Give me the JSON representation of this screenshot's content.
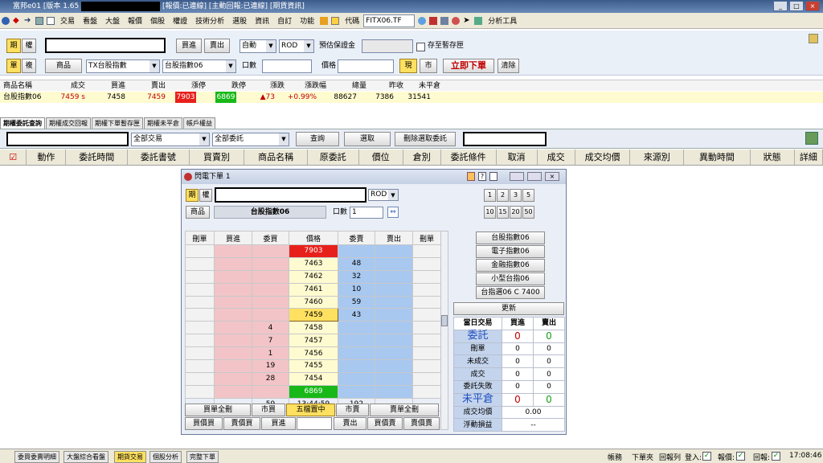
{
  "window": {
    "title": "富邦e01 [版本 1.65",
    "status": "[報價:已連線] [主動回報:已連線] [期貨資訊]",
    "win_buttons": [
      "_",
      "□",
      "×"
    ]
  },
  "menu": {
    "items": [
      "交易",
      "看盤",
      "大盤",
      "報價",
      "個股",
      "權證",
      "技術分析",
      "選股",
      "資訊",
      "自訂",
      "功能"
    ],
    "code_label": "代碼",
    "code_value": "FITX06.TF",
    "analysis_label": "分析工具"
  },
  "order": {
    "btn_futures": "期",
    "btn_options": "權",
    "btn_buy": "買進",
    "btn_sell": "賣出",
    "mode": "自動",
    "rod": "ROD",
    "margin_label": "預估保證金",
    "store_label": "存至暫存匣",
    "btn_single": "單",
    "btn_combo": "複",
    "product_label": "商品",
    "product_value": "TX台股指數",
    "contract_value": "台股指數06",
    "qty_label": "口數",
    "price_label": "價格",
    "btn_current": "現",
    "btn_market": "市",
    "btn_place": "立即下單",
    "btn_clear": "清除"
  },
  "quote": {
    "headers": [
      "商品名稱",
      "成交",
      "買進",
      "賣出",
      "漲停",
      "跌停",
      "漲跌",
      "漲跌幅",
      "總量",
      "昨收",
      "未平倉"
    ],
    "row": [
      "台股指數06",
      "7459 s",
      "7458",
      "7459",
      "7903",
      "6869",
      "▲73",
      "+0.99%",
      "88627",
      "7386",
      "31541"
    ]
  },
  "tabs": [
    "期權委託查詢",
    "期權成交回報",
    "期權下單暫存匣",
    "期權未平倉",
    "帳戶權益"
  ],
  "filter": {
    "f1": "全部交易",
    "f2": "全部委託",
    "query": "查詢",
    "select": "選取",
    "delete_selected": "刪除選取委託"
  },
  "columns": [
    "動作",
    "委託時間",
    "委託書號",
    "買賣別",
    "商品名稱",
    "原委託",
    "價位",
    "倉別",
    "委託條件",
    "取消",
    "成交",
    "成交均價",
    "來源別",
    "異動時間",
    "狀態",
    "詳細"
  ],
  "dialog": {
    "title": "閃電下單 1",
    "btn_futures": "期",
    "btn_options": "權",
    "rod": "ROD",
    "product_btn": "商品",
    "product_name": "台股指數06",
    "qty_label": "口數",
    "qty_value": "1",
    "qty_btns1": [
      "1",
      "2",
      "3",
      "5"
    ],
    "qty_btns2": [
      "10",
      "15",
      "20",
      "50"
    ],
    "ladder_headers": [
      "刪單",
      "買進",
      "委買",
      "價格",
      "委賣",
      "賣出",
      "刪單"
    ],
    "ladder_rows": [
      {
        "bq": "",
        "price": "7903",
        "sq": ""
      },
      {
        "bq": "",
        "price": "7463",
        "sq": "48"
      },
      {
        "bq": "",
        "price": "7462",
        "sq": "32"
      },
      {
        "bq": "",
        "price": "7461",
        "sq": "10"
      },
      {
        "bq": "",
        "price": "7460",
        "sq": "59"
      },
      {
        "bq": "",
        "price": "7459",
        "sq": "43"
      },
      {
        "bq": "4",
        "price": "7458",
        "sq": ""
      },
      {
        "bq": "7",
        "price": "7457",
        "sq": ""
      },
      {
        "bq": "1",
        "price": "7456",
        "sq": ""
      },
      {
        "bq": "19",
        "price": "7455",
        "sq": ""
      },
      {
        "bq": "28",
        "price": "7454",
        "sq": ""
      },
      {
        "bq": "",
        "price": "6869",
        "sq": ""
      },
      {
        "bq": "59",
        "price": "13:44:59",
        "sq": "192"
      }
    ],
    "bottom1": [
      "買單全刪",
      "市買",
      "五檔置中",
      "市賣",
      "賣單全刪"
    ],
    "bottom2": [
      "買價買",
      "賣價買",
      "買進",
      "",
      "賣出",
      "買價賣",
      "賣價賣"
    ],
    "products": [
      "台股指數06",
      "電子指數06",
      "金融指數06",
      "小型台指06",
      "台指選06 C 7400"
    ],
    "refresh": "更新",
    "trade_headers": [
      "當日交易",
      "買進",
      "賣出"
    ],
    "trade_rows": [
      {
        "label": "委託",
        "buy": "0",
        "sell": "0"
      },
      {
        "label": "刪單",
        "buy": "0",
        "sell": "0"
      },
      {
        "label": "未成交",
        "buy": "0",
        "sell": "0"
      },
      {
        "label": "成交",
        "buy": "0",
        "sell": "0"
      },
      {
        "label": "委託失敗",
        "buy": "0",
        "sell": "0"
      },
      {
        "label": "未平倉",
        "buy": "0",
        "sell": "0"
      }
    ],
    "avg_label": "成交均價",
    "avg_value": "0.00",
    "pnl_label": "浮動損益",
    "pnl_value": "--"
  },
  "statusbar": {
    "tabs": [
      "委買委賣明細",
      "大盤綜合看盤",
      "期貨交易",
      "個股分析",
      "完整下單"
    ],
    "right": [
      "帳務",
      "下單夾",
      "回報列",
      "登入:",
      "報價:",
      "回報:"
    ],
    "time": "17:08:46"
  },
  "colors": {
    "limit_up": "#e8201c",
    "limit_down": "#18b818",
    "accent_red": "#c00000"
  }
}
